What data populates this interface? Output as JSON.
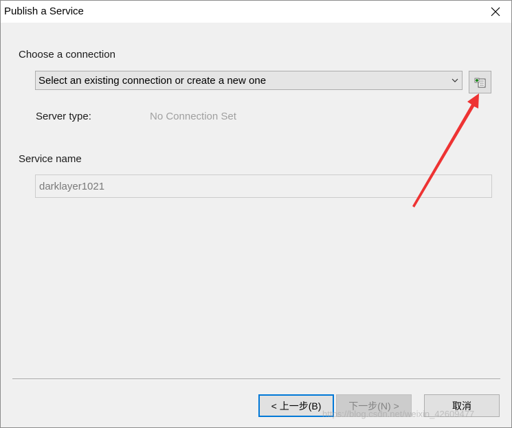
{
  "window": {
    "title": "Publish a Service"
  },
  "connection": {
    "section_label": "Choose a connection",
    "selected_value": "Select an existing connection or create a new one",
    "server_type_label": "Server type:",
    "server_type_value": "No Connection Set"
  },
  "service": {
    "section_label": "Service name",
    "name_value": "darklayer1021"
  },
  "buttons": {
    "back_label": "< 上一步(B)",
    "next_label": "下一步(N) >",
    "cancel_label": "取消"
  },
  "watermark": "https://blog.csdn.net/weixin_42609477",
  "icons": {
    "close": "close-icon",
    "dropdown": "chevron-down-icon",
    "new_connection": "new-connection-icon"
  },
  "colors": {
    "annotation_arrow": "#ee3333",
    "focus_border": "#0078d7"
  }
}
